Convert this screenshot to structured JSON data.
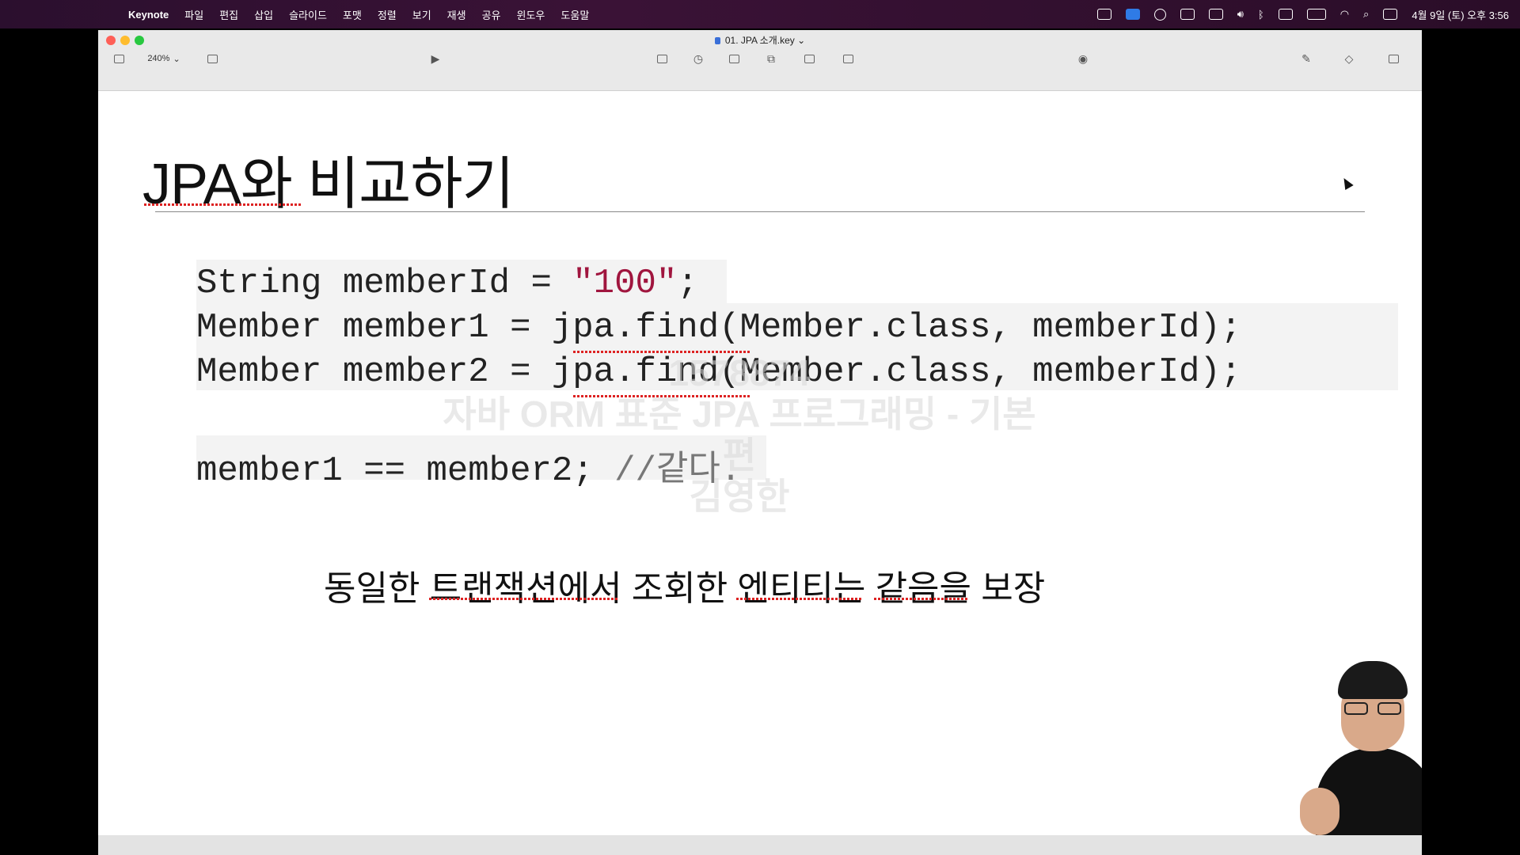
{
  "menubar": {
    "app_name": "Keynote",
    "items": [
      "파일",
      "편집",
      "삽입",
      "슬라이드",
      "포맷",
      "정렬",
      "보기",
      "재생",
      "공유",
      "윈도우",
      "도움말"
    ],
    "datetime": "4월 9일 (토) 오후 3:56"
  },
  "window": {
    "document_title": "01. JPA 소개.key",
    "zoom_level": "240%"
  },
  "slide": {
    "title": "JPA와 비교하기",
    "code": {
      "line1_prefix": "String memberId = ",
      "line1_string": "\"100\"",
      "line1_suffix": ";",
      "line2": "Member member1 = jpa.find(Member.class, memberId);",
      "line3": "Member member2 = jpa.find(Member.class, memberId);",
      "line4_code": "member1 == member2; ",
      "line4_comment": "//같다."
    },
    "note": "동일한 트랜잭션에서 조회한 엔티티는 같음을 보장",
    "watermark": {
      "id": "1578874",
      "course": "자바 ORM 표준 JPA 프로그래밍 - 기본편",
      "author": "김영한"
    }
  },
  "colors": {
    "menubar": "#2b0f2e",
    "string_literal": "#a0153e",
    "comment": "#777777"
  }
}
